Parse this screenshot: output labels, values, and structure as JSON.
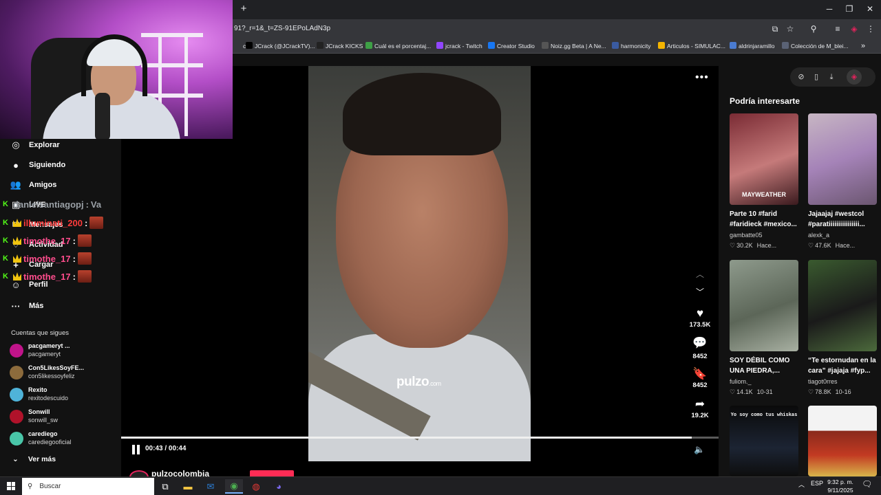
{
  "browser": {
    "url": "91?_r=1&_t=ZS-91EPoLAdN3p",
    "new_tab": "+",
    "bookmarks": [
      {
        "label": "ch",
        "color": "#35363a"
      },
      {
        "label": "JCrack (@JCrackTV)...",
        "color": "#000000"
      },
      {
        "label": "JCrack KICKS",
        "color": "#222222"
      },
      {
        "label": "Cuál es el porcentaj...",
        "color": "#3ea046"
      },
      {
        "label": "jcrack - Twitch",
        "color": "#9146ff"
      },
      {
        "label": "Creator Studio",
        "color": "#1877f2"
      },
      {
        "label": "Noiz.gg Beta | A Ne...",
        "color": "#555555"
      },
      {
        "label": "harmonicity",
        "color": "#3a5ba0"
      },
      {
        "label": "Articulos - SIMULAC...",
        "color": "#f4b400"
      },
      {
        "label": "aldrinjaramillo",
        "color": "#4a7bd0"
      },
      {
        "label": "Colección de M_blei...",
        "color": "#5a6275"
      }
    ],
    "bookmarks_more": "»"
  },
  "sidebar": {
    "nav": [
      {
        "label": "Explorar",
        "icon": "compass-icon",
        "glyph": "◎"
      },
      {
        "label": "Siguiendo",
        "icon": "following-icon",
        "glyph": "●"
      },
      {
        "label": "Amigos",
        "icon": "friends-icon",
        "glyph": "👥"
      },
      {
        "label": "LIVE",
        "icon": "live-icon",
        "glyph": "▣"
      },
      {
        "label": "Mensajes",
        "icon": "messages-icon",
        "glyph": "✉"
      },
      {
        "label": "Actividad",
        "icon": "activity-icon",
        "glyph": "♡"
      },
      {
        "label": "Cargar",
        "icon": "upload-icon",
        "glyph": "+"
      },
      {
        "label": "Perfil",
        "icon": "profile-icon",
        "glyph": "☺"
      },
      {
        "label": "Más",
        "icon": "more-icon",
        "glyph": "···"
      }
    ],
    "following_title": "Cuentas que sigues",
    "accounts": [
      {
        "name": "pacgameryt ...",
        "handle": "pacgameryt",
        "color": "#c0148a"
      },
      {
        "name": "Con5LikesSoyFE...",
        "handle": "con5likessoyfeliz",
        "color": "#8c6b3c"
      },
      {
        "name": "Rexito",
        "handle": "rexitodescuido",
        "color": "#4fb3d9"
      },
      {
        "name": "Sonwill",
        "handle": "sonwill_sw",
        "color": "#b0122a"
      },
      {
        "name": "carediego",
        "handle": "carediegooficial",
        "color": "#49c6a8"
      }
    ],
    "more_accounts": "Ver más"
  },
  "chat": [
    {
      "user": "danielsantiagopj",
      "message": "Va",
      "color": "#9aa0a6",
      "badge": "K",
      "crown": false,
      "emote": false
    },
    {
      "user": "illuminati_200",
      "message": "",
      "color": "#ff3b3b",
      "badge": "K",
      "crown": true,
      "emote": true
    },
    {
      "user": "timothe_17",
      "message": "",
      "color": "#ff4d8d",
      "badge": "K",
      "crown": true,
      "emote": true
    },
    {
      "user": "timothe_17",
      "message": "",
      "color": "#ff4d8d",
      "badge": "K",
      "crown": true,
      "emote": true
    },
    {
      "user": "timothe_17",
      "message": "",
      "color": "#ff4d8d",
      "badge": "K",
      "crown": true,
      "emote": true
    }
  ],
  "player": {
    "watermark": "pulzo",
    "watermark_suffix": ".com",
    "time": "00:43 / 00:44",
    "progress_fraction": 0.955,
    "author": "pulzocolombia",
    "likes": "173.5K",
    "comments": "8452",
    "saves": "8452",
    "shares": "19.2K"
  },
  "recommendations": {
    "title": "Podría interesarte",
    "cards": [
      {
        "caption1": "Parte 10 #farid",
        "caption2": "#faridieck #mexico...",
        "user": "gambatte05",
        "likes": "30.2K",
        "date": "Hace...",
        "overlay": "MAYWEATHER",
        "bg": "linear-gradient(160deg,#7a2b34,#c57a7a 55%,#3a1a1e)"
      },
      {
        "caption1": "Jajaajaj #westcol",
        "caption2": "#paratiiiiiiiiiiiiiiii...",
        "user": "alexk_a",
        "likes": "47.6K",
        "date": "Hace...",
        "overlay": "",
        "bg": "linear-gradient(160deg,#c7b6c3,#a583b8 50%,#6b5670)"
      },
      {
        "caption1": "SOY DÉBIL COMO",
        "caption2": "UNA PIEDRA,...",
        "user": "fuliom._",
        "likes": "14.1K",
        "date": "10-31",
        "overlay": "",
        "bg": "linear-gradient(160deg,#8e9a8c,#5c6658 55%,#a8b0a2)"
      },
      {
        "caption1": "“Te estornudan en la",
        "caption2": "cara” #jajaja #fyp...",
        "user": "tiagot0rres",
        "likes": "78.8K",
        "date": "10-16",
        "overlay": "",
        "bg": "linear-gradient(160deg,#3a5a2f,#1a1a1a 55%,#4c6a3c)"
      },
      {
        "caption1": "",
        "caption2": "",
        "user": "",
        "likes": "",
        "date": "",
        "overlay": "Yo soy como tus whiskas",
        "bg": "linear-gradient(180deg,#0a0a0a,#1c2433 60%,#0d0d0d)"
      },
      {
        "caption1": "",
        "caption2": "",
        "user": "",
        "likes": "",
        "date": "",
        "overlay": "",
        "bg": "linear-gradient(180deg,#f3f3f3 0%,#f3f3f3 35%,#8a2a1c 36%,#c23a22 70%,#d8b44a 100%)"
      }
    ]
  },
  "taskbar": {
    "search_placeholder": "Buscar",
    "lang": "ESP",
    "time": "9:32 p. m.",
    "date": "9/11/2025"
  }
}
